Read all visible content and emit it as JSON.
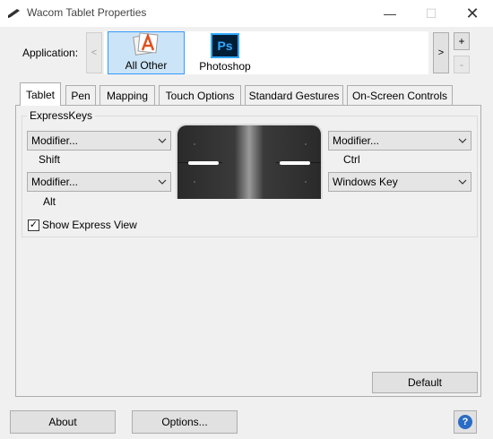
{
  "window": {
    "title": "Wacom Tablet Properties",
    "min_glyph": "—",
    "max_glyph": "☐",
    "close_glyph": "✕"
  },
  "applications": {
    "label": "Application:",
    "prev_glyph": "<",
    "next_glyph": ">",
    "add_glyph": "+",
    "remove_glyph": "-",
    "items": [
      {
        "label": "All Other",
        "icon": "all-other-icon",
        "selected": true
      },
      {
        "label": "Photoshop",
        "icon": "photoshop-icon",
        "icon_text": "Ps",
        "selected": false
      }
    ]
  },
  "tabs": [
    {
      "label": "Tablet",
      "active": true
    },
    {
      "label": "Pen",
      "active": false
    },
    {
      "label": "Mapping",
      "active": false
    },
    {
      "label": "Touch Options",
      "active": false
    },
    {
      "label": "Standard Gestures",
      "active": false
    },
    {
      "label": "On-Screen Controls",
      "active": false
    }
  ],
  "expresskeys": {
    "group_label": "ExpressKeys",
    "top_left": {
      "value": "Modifier...",
      "sub": "Shift"
    },
    "bottom_left": {
      "value": "Modifier...",
      "sub": "Alt"
    },
    "top_right": {
      "value": "Modifier...",
      "sub": "Ctrl"
    },
    "bottom_right": {
      "value": "Windows Key"
    }
  },
  "show_express_view": {
    "label": "Show Express View",
    "checked": true,
    "check_glyph": "✓"
  },
  "buttons": {
    "default": "Default",
    "about": "About",
    "options": "Options...",
    "help": "?"
  },
  "colors": {
    "selection_bg": "#cce4f7",
    "selection_border": "#3399ff",
    "ps_blue": "#31a8ff",
    "ps_bg": "#001e36",
    "help_blue": "#2b6cc4"
  }
}
